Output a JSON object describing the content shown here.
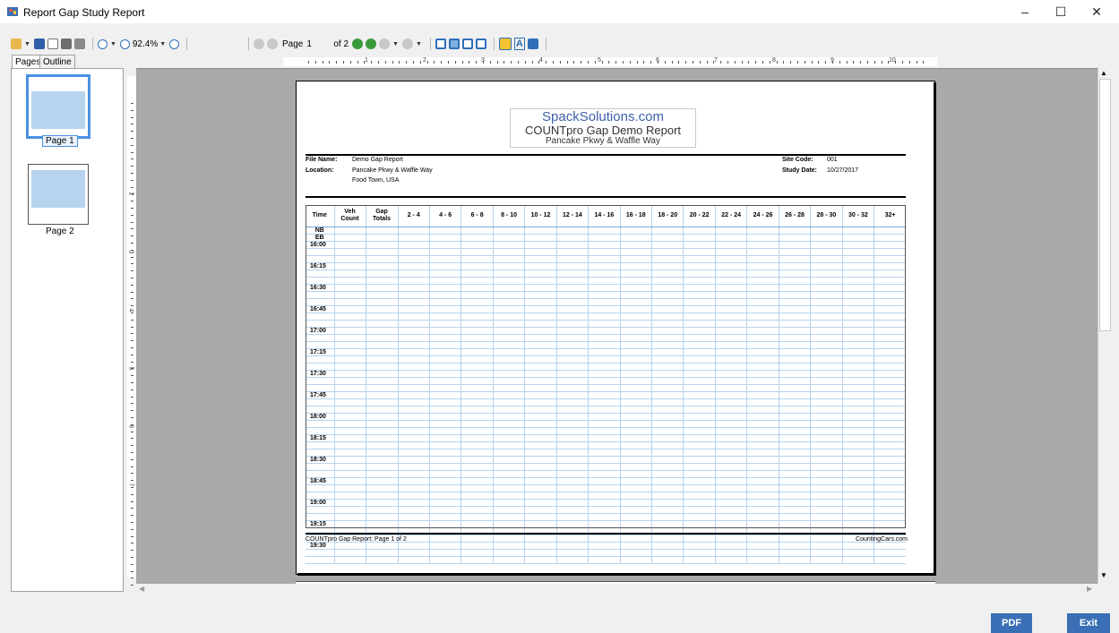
{
  "window": {
    "title": "Report Gap Study Report",
    "minimize": "–",
    "maximize": "☐",
    "close": "✕"
  },
  "toolbar": {
    "zoom": "92.4%",
    "page_label": "Page",
    "page_value": "1",
    "of_pages": "of 2",
    "text_tool": "A"
  },
  "tabs": {
    "pages": "Pages",
    "outline": "Outline"
  },
  "thumbnails": [
    {
      "label": "Page 1",
      "selected": true
    },
    {
      "label": "Page 2",
      "selected": false
    }
  ],
  "ruler": {
    "horizontal": [
      "1",
      "2",
      "3",
      "4",
      "5",
      "6",
      "7",
      "8",
      "9",
      "10"
    ],
    "vertical": [
      "2",
      "3",
      "4",
      "5",
      "6",
      "7"
    ]
  },
  "report": {
    "company": "SpackSolutions.com",
    "title": "COUNTpro Gap Demo Report",
    "subtitle": "Pancake Pkwy & Waffle Way",
    "file_name_label": "File Name:",
    "file_name": "Demo Gap Report",
    "location_label": "Location:",
    "location_line1": "Pancake Pkwy & Waffle Way",
    "location_line2": "Food Town, USA",
    "site_code_label": "Site Code:",
    "site_code": "001",
    "study_date_label": "Study Date:",
    "study_date": "10/27/2017",
    "table": {
      "headers": [
        "Time",
        "Veh Count",
        "Gap Totals",
        "2 - 4",
        "4 - 6",
        "6 - 8",
        "8 - 10",
        "10 - 12",
        "12 - 14",
        "14 - 16",
        "16 - 18",
        "18 - 20",
        "20 - 22",
        "22 - 24",
        "24 - 26",
        "26 - 28",
        "28 - 30",
        "30 - 32",
        "32+"
      ],
      "direction_rows": [
        "NB",
        "EB"
      ],
      "times": [
        "16:00",
        "16:15",
        "16:30",
        "16:45",
        "17:00",
        "17:15",
        "17:30",
        "17:45",
        "18:00",
        "18:15",
        "18:30",
        "18:45",
        "19:00",
        "19:15",
        "19:30"
      ]
    },
    "footer_left": "COUNTpro Gap Report: Page 1 of 2",
    "footer_right": "CountingCars.com"
  },
  "buttons": {
    "pdf": "PDF",
    "exit": "Exit"
  },
  "colors": {
    "accent": "#3a6fb5",
    "grid": "#b7d3ee",
    "company": "#3d5fa8"
  }
}
